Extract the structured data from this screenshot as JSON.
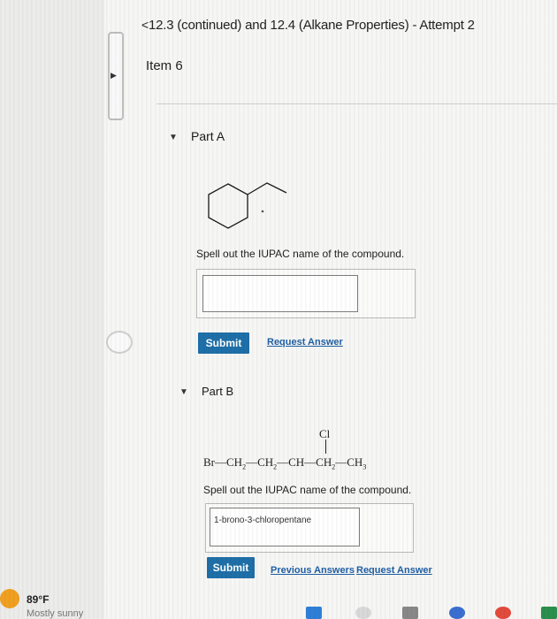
{
  "header": {
    "back_chevron": "<",
    "title": "12.3 (continued) and 12.4 (Alkane Properties) - Attempt 2",
    "item_label": "Item 6"
  },
  "partA": {
    "label": "Part A",
    "prompt": "Spell out the IUPAC name of the compound.",
    "answer_value": "",
    "submit_label": "Submit",
    "request_answer_label": "Request Answer"
  },
  "partB": {
    "label": "Part B",
    "formula": {
      "substituent": "Cl",
      "chain": "Br—CH2—CH2—CH—CH2—CH3"
    },
    "prompt": "Spell out the IUPAC name of the compound.",
    "answer_value": "1-brono-3-chloropentane",
    "submit_label": "Submit",
    "previous_answers_label": "Previous Answers",
    "request_answer_label": "Request Answer"
  },
  "taskbar": {
    "temperature": "89°F",
    "condition": "Mostly sunny"
  },
  "colors": {
    "submit_button": "#1f6fa8",
    "link": "#1f5fa5",
    "weather_icon": "#f0a020"
  }
}
